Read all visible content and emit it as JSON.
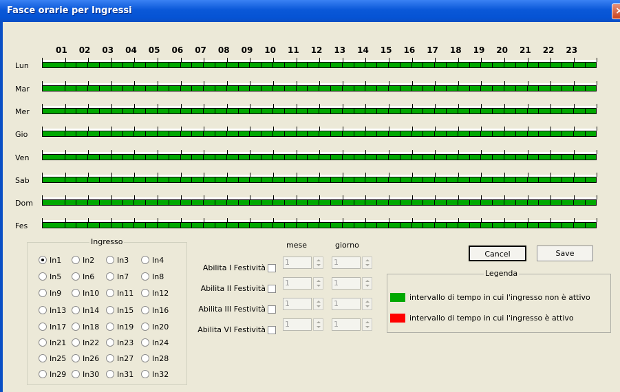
{
  "window": {
    "title": "Fasce orarie per Ingressi",
    "close_glyph": "×"
  },
  "schedule": {
    "hours": [
      "01",
      "02",
      "03",
      "04",
      "05",
      "06",
      "07",
      "08",
      "09",
      "10",
      "11",
      "12",
      "13",
      "14",
      "15",
      "16",
      "17",
      "18",
      "19",
      "20",
      "21",
      "22",
      "23"
    ],
    "days": [
      "Lun",
      "Mar",
      "Mer",
      "Gio",
      "Ven",
      "Sab",
      "Dom",
      "Fes"
    ],
    "cell_color": "#00A800"
  },
  "ingresso": {
    "group_label": "Ingresso",
    "selected": "In1",
    "options": [
      "In1",
      "In2",
      "In3",
      "In4",
      "In5",
      "In6",
      "In7",
      "In8",
      "In9",
      "In10",
      "In11",
      "In12",
      "In13",
      "In14",
      "In15",
      "In16",
      "In17",
      "In18",
      "In19",
      "In20",
      "In21",
      "In22",
      "In23",
      "In24",
      "In25",
      "In26",
      "In27",
      "In28",
      "In29",
      "In30",
      "In31",
      "In32"
    ]
  },
  "festivita": {
    "mese_label": "mese",
    "giorno_label": "giorno",
    "rows": [
      {
        "label": "Abilita I Festività",
        "mese": "1",
        "giorno": "1"
      },
      {
        "label": "Abilita II Festività",
        "mese": "1",
        "giorno": "1"
      },
      {
        "label": "Abilita III Festività",
        "mese": "1",
        "giorno": "1"
      },
      {
        "label": "Abilita VI Festività",
        "mese": "1",
        "giorno": "1"
      }
    ]
  },
  "buttons": {
    "cancel": "Cancel",
    "save": "Save"
  },
  "legenda": {
    "group_label": "Legenda",
    "items": [
      {
        "color": "#00A800",
        "text": "intervallo di tempo in cui l'ingresso non è attivo"
      },
      {
        "color": "#FF0000",
        "text": "intervallo di tempo in cui l'ingresso è attivo"
      }
    ]
  }
}
